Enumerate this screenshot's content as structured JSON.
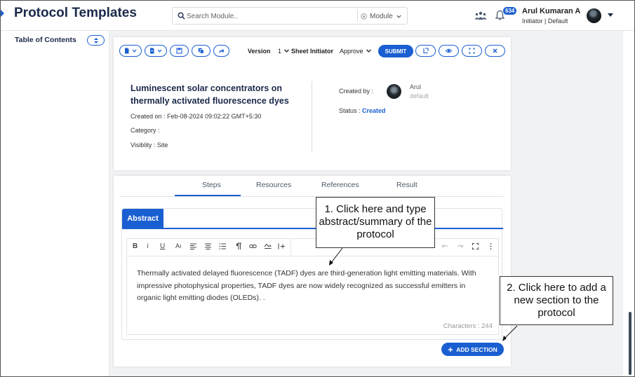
{
  "header": {
    "app_title": "Protocol Templates",
    "search": {
      "placeholder": "Search Module..",
      "module_label": "Module"
    },
    "notification_count": "634",
    "user": {
      "name": "Arul Kumaran A",
      "role": "Initiator | Default"
    }
  },
  "sidebar": {
    "title": "Table of Contents"
  },
  "toolbar": {
    "version_label": "Version",
    "version_value": "1",
    "sheet_initiator_label": "Sheet Initiator",
    "approve_value": "Approve",
    "submit_label": "SUBMIT"
  },
  "protocol": {
    "title": "Luminescent solar concentrators on thermally activated fluorescence dyes",
    "created_on": "Created on : Feb-08-2024 09:02:22 GMT+5:30",
    "category": "Category :",
    "visibility": "Visiblity : Site",
    "created_by_label": "Created by :",
    "owner_name": "Arul",
    "owner_sub": "default",
    "status_label": "Status :",
    "status_value": "Created"
  },
  "tabs": [
    "Steps",
    "Resources",
    "References",
    "Result"
  ],
  "section": {
    "tab_label": "Abstract",
    "body": "Thermally activated delayed fluorescence (TADF) dyes are third-generation light emitting materials. With impressive photophysical properties, TADF dyes are now widely recognized as successful emitters in organic light emitting diodes (OLEDs). .",
    "char_count": "Characters : 244",
    "font_size_label": "Aı"
  },
  "add_section_label": "ADD SECTION",
  "callouts": {
    "one": "1. Click here and type abstract/summary of the protocol",
    "two": "2. Click here to add a new section to the protocol"
  },
  "colors": {
    "accent": "#1a5fd1",
    "title": "#1b2a4a"
  },
  "icons": [
    "search-icon",
    "team-icon",
    "bell-icon",
    "chevron-down-icon",
    "sort-icon",
    "file-icon",
    "save-icon",
    "copy-icon",
    "share-icon",
    "history-icon",
    "eye-icon",
    "expand-icon",
    "close-icon",
    "plus-icon"
  ]
}
